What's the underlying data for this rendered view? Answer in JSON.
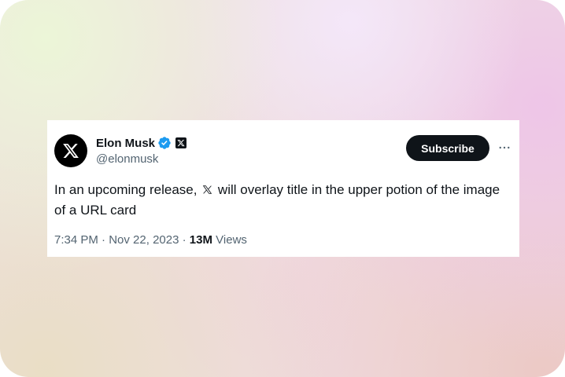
{
  "tweet": {
    "author": {
      "name": "Elon Musk",
      "handle": "@elonmusk",
      "verified": true,
      "avatar_icon": "x-logo-icon",
      "affiliation_icon": "x-affiliate-badge-icon"
    },
    "subscribe_label": "Subscribe",
    "more_icon": "more-horizontal-icon",
    "text_before": "In an upcoming release,",
    "text_after": "will overlay title in the upper potion of the image of a URL card",
    "inline_icon": "x-logo-icon",
    "time": "7:34 PM",
    "separator": "·",
    "date": "Nov 22, 2023",
    "views_count": "13M",
    "views_label": "Views"
  },
  "colors": {
    "text_primary": "#0f1419",
    "text_secondary": "#536471",
    "verified_blue": "#1d9bf0",
    "button_bg": "#0f1419",
    "card_bg": "#ffffff"
  }
}
